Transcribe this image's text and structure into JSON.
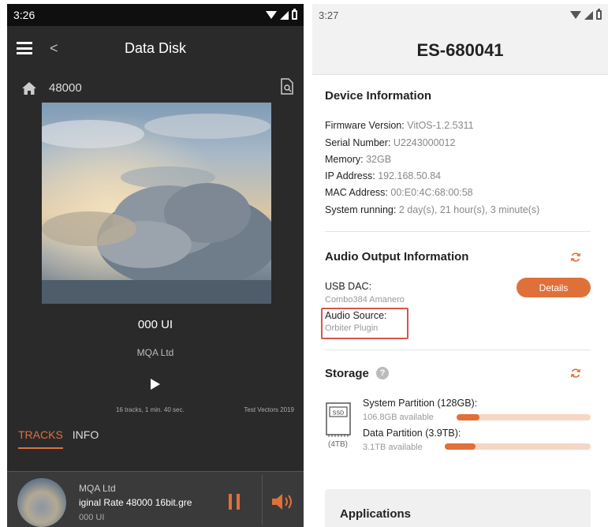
{
  "left": {
    "status": {
      "time": "3:26"
    },
    "appbar": {
      "back": "<",
      "title": "Data Disk"
    },
    "path": {
      "label": "48000"
    },
    "track": {
      "title": "000 UI",
      "artist": "MQA Ltd",
      "summary": "16 tracks, 1 min. 40 sec.",
      "album_note": "Test Vectors  2019"
    },
    "tabs": [
      {
        "label": "TRACKS"
      },
      {
        "label": "INFO"
      }
    ],
    "miniplayer": {
      "artist": "MQA Ltd",
      "rate_line": "iginal Rate 48000 16bit.gre",
      "title": "000 UI"
    },
    "colors": {
      "accent": "#e0703a",
      "bg": "#2a2a2a"
    }
  },
  "right": {
    "status": {
      "time": "3:27"
    },
    "header": {
      "title": "ES-680041"
    },
    "device": {
      "title": "Device Information",
      "rows": [
        {
          "label": "Firmware Version:",
          "value": "VitOS-1.2.5311"
        },
        {
          "label": "Serial Number:",
          "value": "U2243000012"
        },
        {
          "label": "Memory:",
          "value": "32GB"
        },
        {
          "label": "IP Address:",
          "value": "192.168.50.84"
        },
        {
          "label": "MAC Address:",
          "value": "00:E0:4C:68:00:58"
        },
        {
          "label": "System running:",
          "value": "2 day(s), 21 hour(s), 3 minute(s)"
        }
      ]
    },
    "audio": {
      "title": "Audio Output Information",
      "usb_label": "USB DAC:",
      "usb_value": "Combo384 Amanero",
      "source_label": "Audio Source:",
      "source_value": "Orbiter Plugin",
      "details_label": "Details"
    },
    "storage": {
      "title": "Storage",
      "help": "?",
      "drive_label": "SSD",
      "drive_size": "(4TB)",
      "partitions": [
        {
          "label": "System Partition (128GB):",
          "available": "106.8GB available",
          "used_fraction": 0.17
        },
        {
          "label": "Data Partition (3.9TB):",
          "available": "3.1TB available",
          "used_fraction": 0.21
        }
      ]
    },
    "applications": {
      "title": "Applications"
    },
    "colors": {
      "accent": "#e0703a",
      "highlight": "#d9544a"
    }
  }
}
